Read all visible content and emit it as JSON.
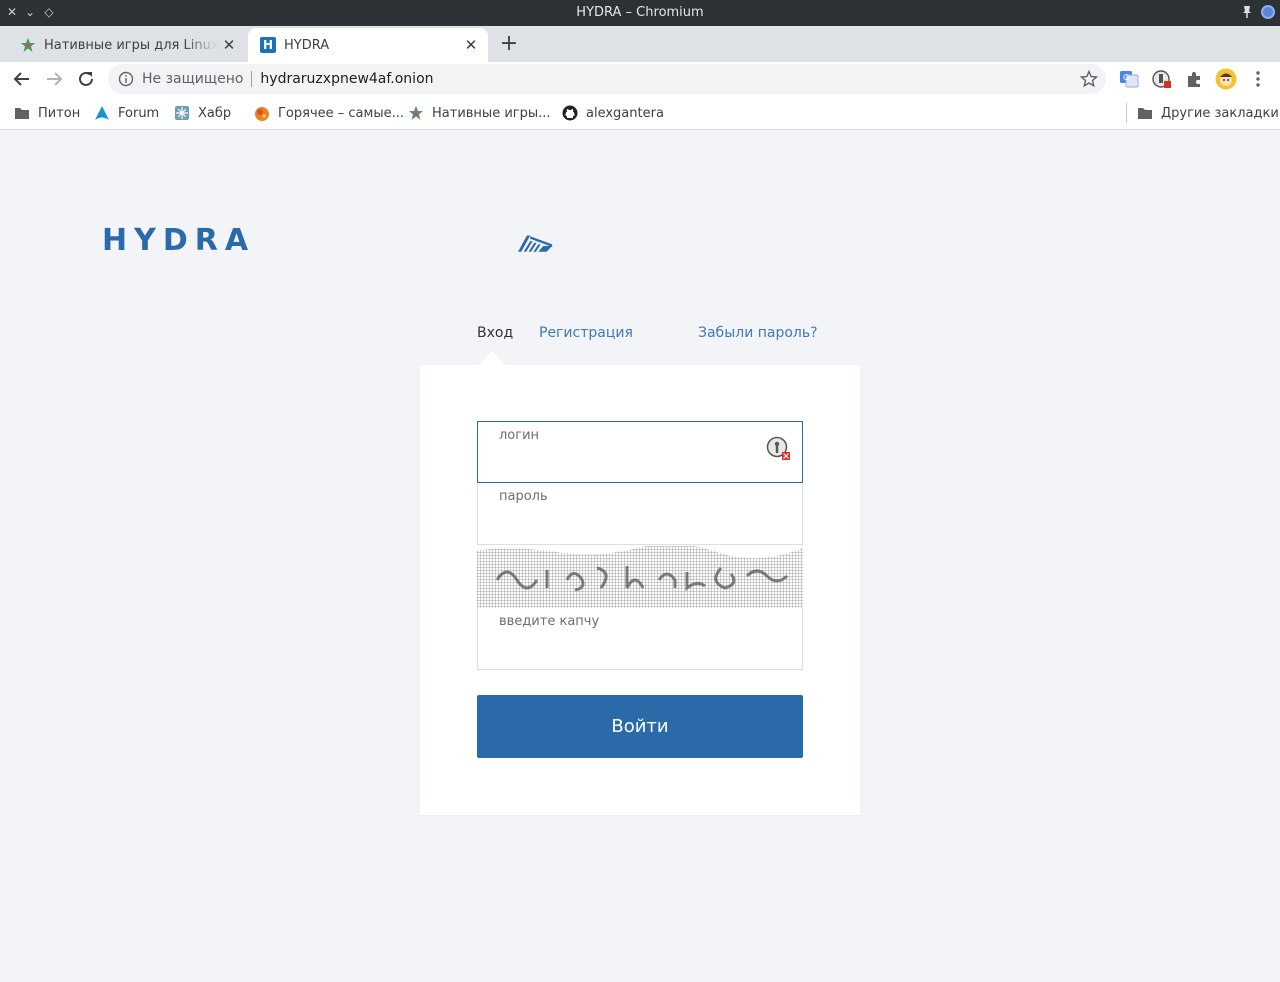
{
  "window": {
    "title": "HYDRA – Chromium"
  },
  "tabs": [
    {
      "title": "Нативные игры для Linux [c",
      "active": false
    },
    {
      "title": "HYDRA",
      "active": true
    }
  ],
  "toolbar": {
    "security_label": "Не защищено",
    "url": "hydraruzxpnew4af.onion"
  },
  "bookmarks": {
    "items": [
      {
        "label": "Питон",
        "icon": "folder-icon"
      },
      {
        "label": "Forum",
        "icon": "arch-icon"
      },
      {
        "label": "Хабр",
        "icon": "habr-icon"
      },
      {
        "label": "Горячее – самые...",
        "icon": "pikabu-icon"
      },
      {
        "label": "Нативные игры...",
        "icon": "star-logo-icon"
      },
      {
        "label": "alexgantera",
        "icon": "github-icon"
      }
    ],
    "other_label": "Другие закладки"
  },
  "page": {
    "logo_text": "HYDRA",
    "auth_tabs": {
      "login": "Вход",
      "register": "Регистрация",
      "forgot": "Забыли пароль?"
    },
    "form": {
      "login_label": "логин",
      "password_label": "пароль",
      "captcha_label": "введите капчу",
      "submit_label": "Войти"
    }
  },
  "colors": {
    "brand": "#2b6aa8",
    "link": "#3d7ab8",
    "page_bg": "#f3f4f7"
  }
}
